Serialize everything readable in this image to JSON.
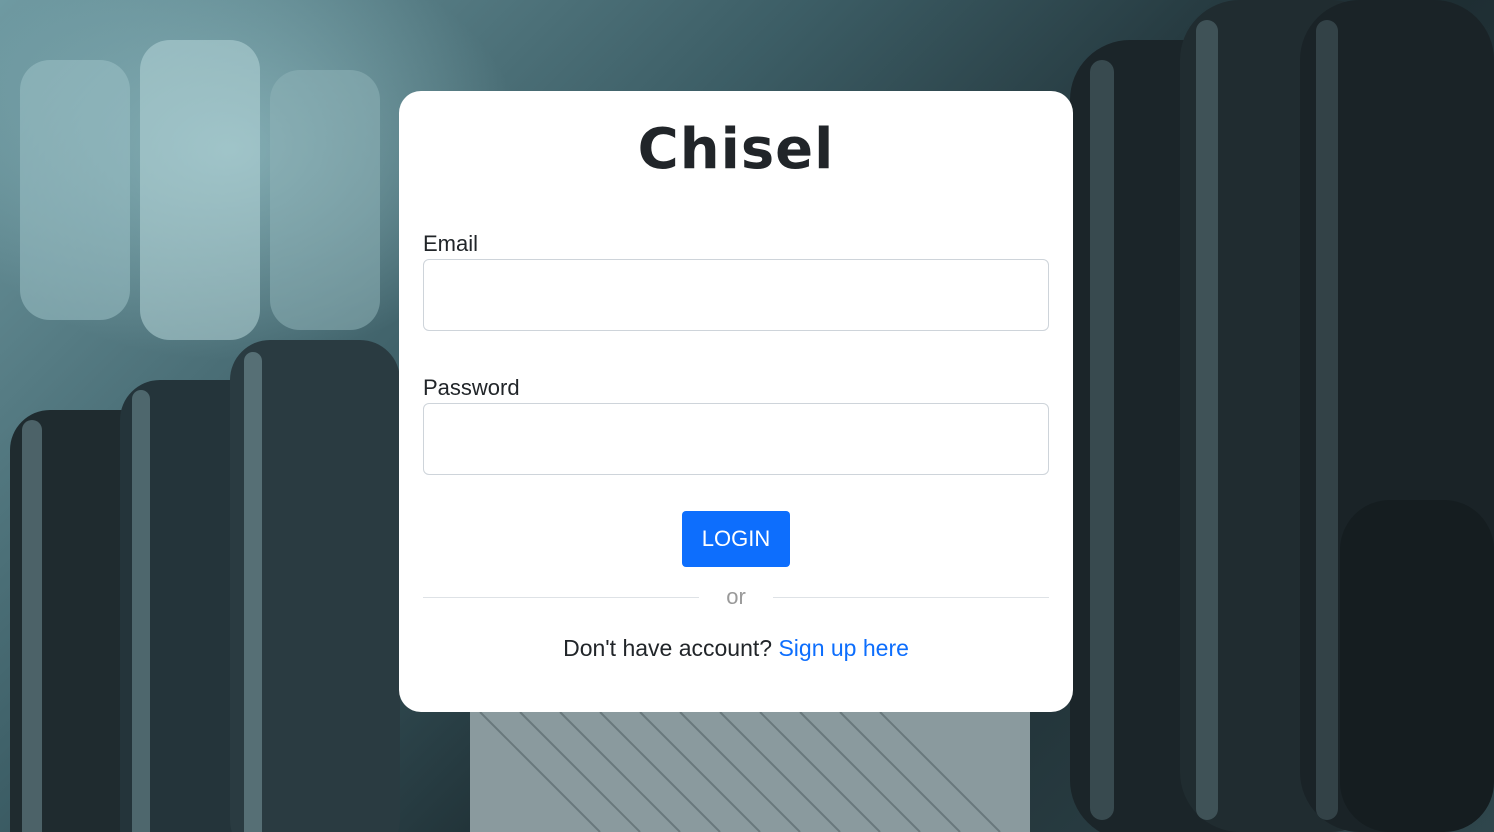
{
  "brand": {
    "title": "Chisel"
  },
  "form": {
    "email_label": "Email",
    "email_value": "",
    "password_label": "Password",
    "password_value": "",
    "login_label": "LOGIN",
    "divider_text": "or",
    "signup_prompt": "Don't have account?",
    "signup_link": "Sign up here"
  },
  "colors": {
    "primary": "#0d6efd",
    "card_background": "#ffffff",
    "text": "#212529",
    "muted": "#9a9a9a"
  },
  "background": {
    "subject": "dumbbell-weight-plates-photo"
  }
}
